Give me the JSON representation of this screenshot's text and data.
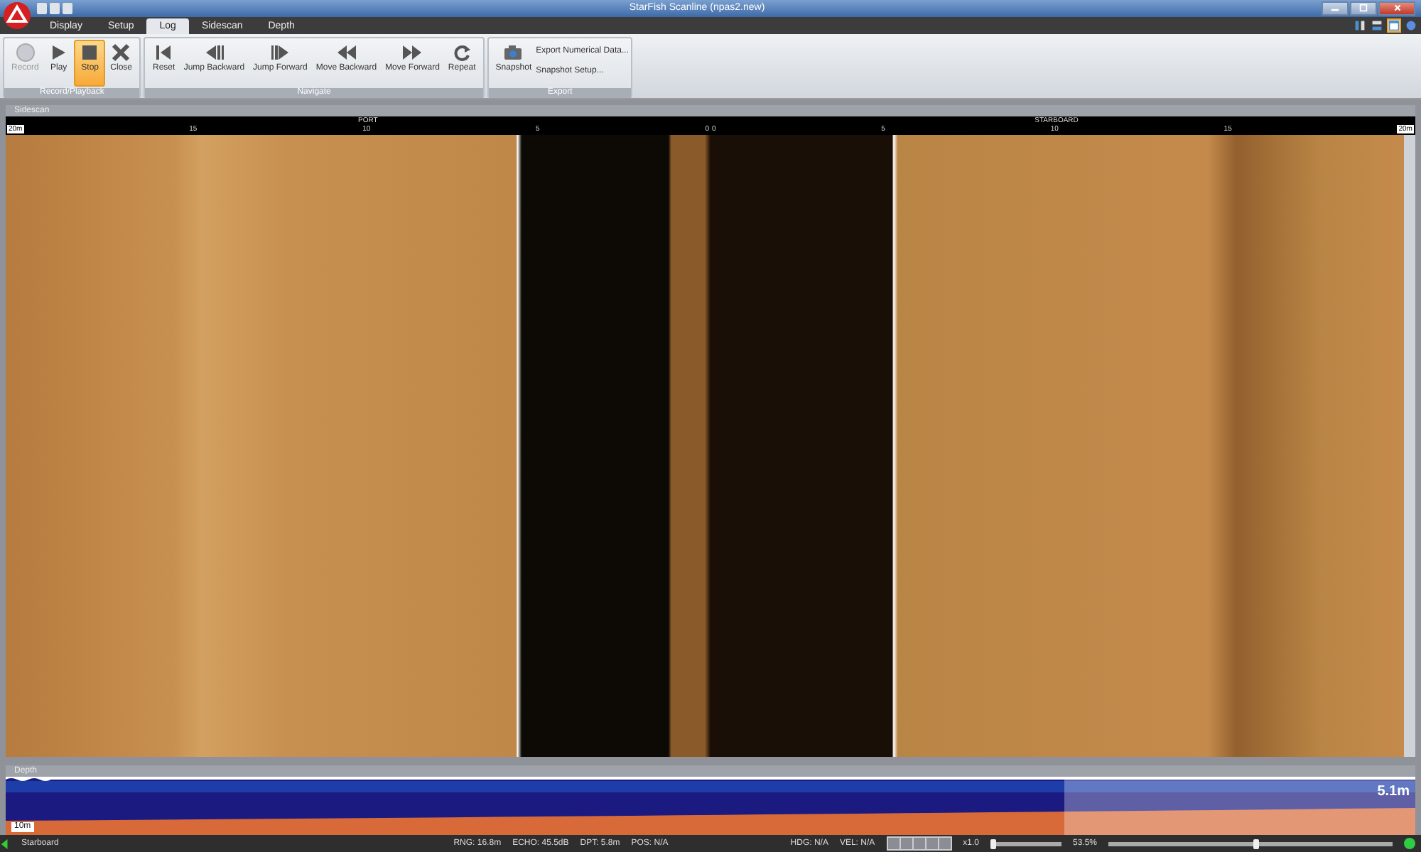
{
  "window": {
    "title": "StarFish Scanline (npas2.new)"
  },
  "tabs": [
    {
      "label": "Display",
      "selected": false
    },
    {
      "label": "Setup",
      "selected": false
    },
    {
      "label": "Log",
      "selected": true
    },
    {
      "label": "Sidescan",
      "selected": false
    },
    {
      "label": "Depth",
      "selected": false
    }
  ],
  "view_buttons": [
    {
      "kind": "columns",
      "selected": false
    },
    {
      "kind": "rows",
      "selected": false
    },
    {
      "kind": "window",
      "selected": true
    },
    {
      "kind": "help",
      "selected": false
    }
  ],
  "ribbon_groups": [
    {
      "title": "Record/Playback",
      "buttons": [
        {
          "kind": "record",
          "label": "Record",
          "disabled": true,
          "selected": false
        },
        {
          "kind": "play",
          "label": "Play",
          "disabled": false,
          "selected": false
        },
        {
          "kind": "stop",
          "label": "Stop",
          "disabled": false,
          "selected": true
        },
        {
          "kind": "close",
          "label": "Close",
          "disabled": false,
          "selected": false
        }
      ]
    },
    {
      "title": "Navigate",
      "buttons": [
        {
          "kind": "reset",
          "label": "Reset",
          "disabled": false,
          "selected": false
        },
        {
          "kind": "jumpback",
          "label": "Jump Backward",
          "disabled": false,
          "selected": false
        },
        {
          "kind": "jumpfwd",
          "label": "Jump Forward",
          "disabled": false,
          "selected": false
        },
        {
          "kind": "moveback",
          "label": "Move Backward",
          "disabled": false,
          "selected": false
        },
        {
          "kind": "movefwd",
          "label": "Move Forward",
          "disabled": false,
          "selected": false
        },
        {
          "kind": "repeat",
          "label": "Repeat",
          "disabled": false,
          "selected": false
        }
      ]
    },
    {
      "title": "Export",
      "buttons": [
        {
          "kind": "snapshot",
          "label": "Snapshot",
          "disabled": false,
          "selected": false
        }
      ],
      "links": [
        "Export Numerical Data...",
        "Snapshot Setup..."
      ]
    }
  ],
  "sidescan": {
    "title": "Sidescan",
    "port_label": "PORT",
    "starboard_label": "STARBOARD",
    "port_ticks": [
      "20m",
      "15",
      "10",
      "5",
      "0"
    ],
    "starboard_ticks": [
      "0",
      "5",
      "10",
      "15",
      "20m"
    ]
  },
  "depth": {
    "title": "Depth",
    "reading": "5.1m",
    "scale": "10m"
  },
  "status_bar": {
    "side": "Starboard",
    "readings": [
      "RNG: 16.8m",
      "ECHO: 45.5dB",
      "DPT: 5.8m",
      "POS: N/A"
    ],
    "readings_right": [
      "HDG: N/A",
      "VEL: N/A"
    ],
    "speed": "x1.0",
    "speed_slider": {
      "level": 0.05
    },
    "zoom": "53.5%",
    "zoom_slider": {
      "level": 0.52
    },
    "connected": true
  }
}
